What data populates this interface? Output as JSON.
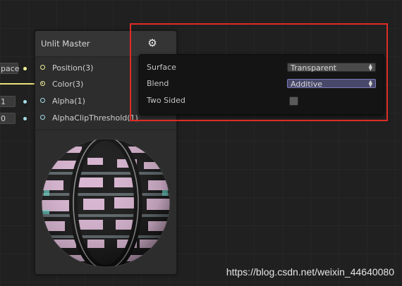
{
  "colors": {
    "highlight_box": "#e02c24",
    "port_position": "#f0f09a",
    "port_color": "#f0f09a",
    "port_alpha": "#a6dce8",
    "port_alpha_clip": "#a6dce8",
    "wire_color": "#e9e178",
    "active_dropdown": "#48486a"
  },
  "left_inputs": {
    "space_value": "pace",
    "alpha_value": "1",
    "alpha_clip_value": "0"
  },
  "node": {
    "title": "Unlit Master",
    "ports": [
      {
        "label": "Position(3)",
        "icon": "port-circle-icon"
      },
      {
        "label": "Color(3)",
        "icon": "port-connected-icon"
      },
      {
        "label": "Alpha(1)",
        "icon": "port-circle-icon"
      },
      {
        "label": "AlphaClipThreshold(1)",
        "icon": "port-circle-icon"
      }
    ],
    "preview": "sphere-preview"
  },
  "settings": {
    "gear_icon": "gear-icon",
    "surface": {
      "label": "Surface",
      "value": "Transparent"
    },
    "blend": {
      "label": "Blend",
      "value": "Additive"
    },
    "two_sided": {
      "label": "Two Sided",
      "checked": false
    }
  },
  "watermark": "https://blog.csdn.net/weixin_44640080"
}
